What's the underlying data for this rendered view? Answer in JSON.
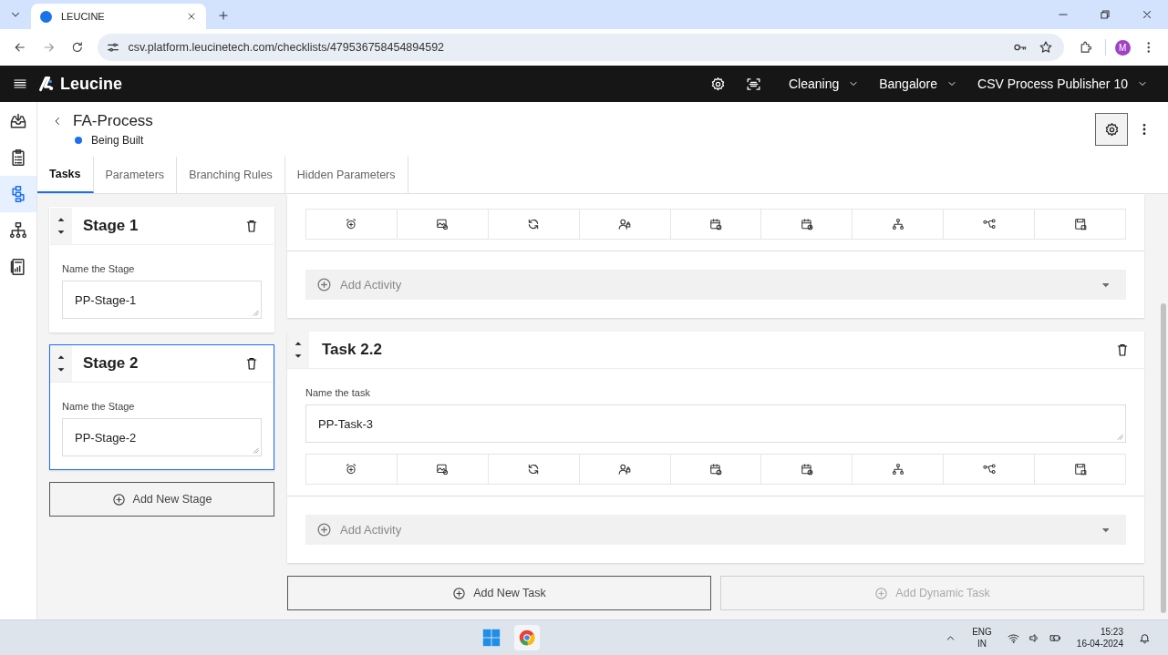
{
  "browser": {
    "tab_title": "LEUCINE",
    "url": "csv.platform.leucinetech.com/checklists/479536758454894592",
    "profile_initial": "M"
  },
  "app_header": {
    "brand": "Leucine",
    "selectors": [
      "Cleaning",
      "Bangalore",
      "CSV Process Publisher 10"
    ]
  },
  "sidebar": {
    "items": [
      {
        "selected": false
      },
      {
        "selected": false
      },
      {
        "selected": true
      },
      {
        "selected": false
      },
      {
        "selected": false
      }
    ]
  },
  "page": {
    "title": "FA-Process",
    "status": "Being Built"
  },
  "tabs": [
    {
      "label": "Tasks",
      "selected": true
    },
    {
      "label": "Parameters",
      "selected": false
    },
    {
      "label": "Branching Rules",
      "selected": false
    },
    {
      "label": "Hidden Parameters",
      "selected": false
    }
  ],
  "stages": [
    {
      "title": "Stage 1",
      "label": "Name the Stage",
      "value": "PP-Stage-1",
      "selected": false
    },
    {
      "title": "Stage 2",
      "label": "Name the Stage",
      "value": "PP-Stage-2",
      "selected": true
    }
  ],
  "add_stage": "Add New Stage",
  "tasks": [
    {
      "add_activity": "Add Activity"
    },
    {
      "title": "Task 2.2",
      "label": "Name the task",
      "value": "PP-Task-3",
      "add_activity": "Add Activity"
    }
  ],
  "task_buttons": [
    {
      "label": "Add New Task",
      "disabled": false
    },
    {
      "label": "Add Dynamic Task",
      "disabled": true
    }
  ],
  "taskbar": {
    "language": "ENG",
    "region": "IN",
    "time": "15:23",
    "date": "16-04-2024"
  }
}
